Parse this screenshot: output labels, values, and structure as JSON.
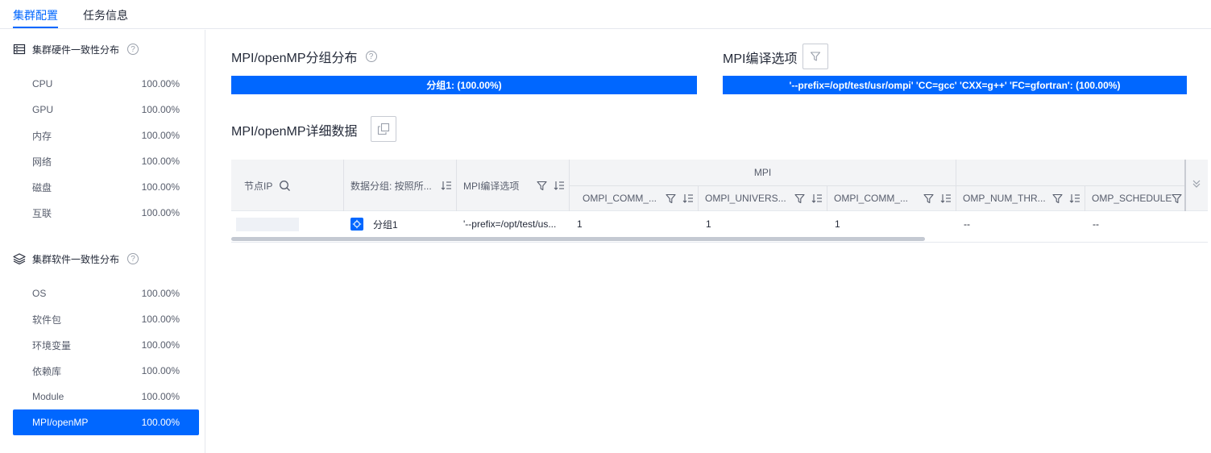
{
  "tabs": [
    {
      "label": "集群配置",
      "active": true
    },
    {
      "label": "任务信息",
      "active": false
    }
  ],
  "sidebar": {
    "hardware": {
      "title": "集群硬件一致性分布",
      "help": "?",
      "icon": "server-icon",
      "items": [
        {
          "label": "CPU",
          "value": "100.00%"
        },
        {
          "label": "GPU",
          "value": "100.00%"
        },
        {
          "label": "内存",
          "value": "100.00%"
        },
        {
          "label": "网络",
          "value": "100.00%"
        },
        {
          "label": "磁盘",
          "value": "100.00%"
        },
        {
          "label": "互联",
          "value": "100.00%"
        }
      ]
    },
    "software": {
      "title": "集群软件一致性分布",
      "help": "?",
      "icon": "layers-icon",
      "items": [
        {
          "label": "OS",
          "value": "100.00%"
        },
        {
          "label": "软件包",
          "value": "100.00%"
        },
        {
          "label": "环境变量",
          "value": "100.00%"
        },
        {
          "label": "依赖库",
          "value": "100.00%"
        },
        {
          "label": "Module",
          "value": "100.00%"
        },
        {
          "label": "MPI/openMP",
          "value": "100.00%",
          "active": true
        }
      ]
    }
  },
  "main": {
    "group_dist": {
      "title": "MPI/openMP分组分布",
      "help": "?",
      "bar_label": "分组1: (100.00%)",
      "bar_fraction": 1.0
    },
    "compile_opts": {
      "title": "MPI编译选项",
      "bar_label": "'--prefix=/opt/test/usr/ompi' 'CC=gcc' 'CXX=g++' 'FC=gfortran': (100.00%)",
      "bar_fraction": 1.0
    },
    "detail": {
      "title": "MPI/openMP详细数据"
    }
  },
  "table": {
    "group_header": "MPI",
    "columns": [
      {
        "label": "节点IP"
      },
      {
        "label": "数据分组: 按照所..."
      },
      {
        "label": "MPI编译选项"
      },
      {
        "label": "OMPI_COMM_..."
      },
      {
        "label": "OMPI_UNIVERS..."
      },
      {
        "label": "OMPI_COMM_..."
      },
      {
        "label": "OMP_NUM_THR..."
      },
      {
        "label": "OMP_SCHEDULE"
      }
    ],
    "row": {
      "node_ip": "",
      "group": "分组1",
      "compile": "'--prefix=/opt/test/us...",
      "c1": "1",
      "c2": "1",
      "c3": "1",
      "c4": "--",
      "c5": "--"
    }
  },
  "colors": {
    "accent": "#0067ff",
    "text": "#252b3a",
    "muted": "#575d6c",
    "header_bg": "#f3f4f6"
  }
}
